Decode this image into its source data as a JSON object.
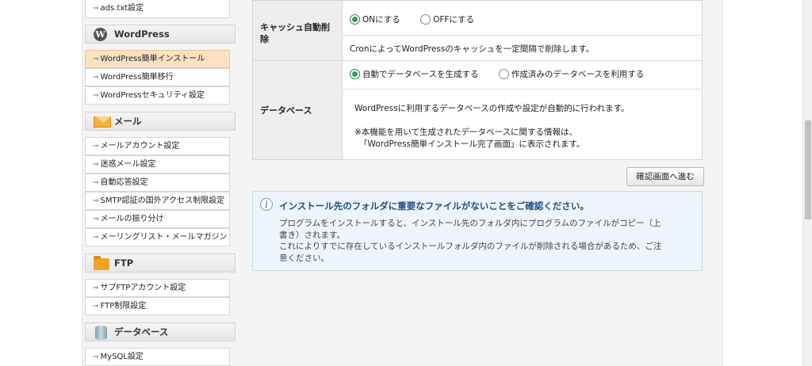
{
  "sidebar": {
    "links_top": [
      "ads.txt設定"
    ],
    "wordpress": {
      "title": "WordPress",
      "icon": "wordpress-logo-icon",
      "items": [
        "WordPress簡単インストール",
        "WordPress簡単移行",
        "WordPressセキュリティ設定"
      ],
      "active_index": 0
    },
    "mail": {
      "title": "メール",
      "icon": "envelope-icon",
      "items": [
        "メールアカウント設定",
        "迷惑メール設定",
        "自動応答設定",
        "SMTP認証の国外アクセス制限設定",
        "メールの振り分け",
        "メーリングリスト・メールマガジン"
      ]
    },
    "ftp": {
      "title": "FTP",
      "icon": "folder-icon",
      "items": [
        "サブFTPアカウント設定",
        "FTP制限設定"
      ]
    },
    "database": {
      "title": "データベース",
      "icon": "database-icon",
      "items": [
        "MySQL設定"
      ]
    }
  },
  "form": {
    "cache": {
      "label": "キャッシュ自動削除",
      "options": [
        "ONにする",
        "OFFにする"
      ],
      "selected": 0,
      "description": "CronによってWordPressのキャッシュを一定間隔で削除します。"
    },
    "database": {
      "label": "データベース",
      "options": [
        "自動でデータベースを生成する",
        "作成済みのデータベースを利用する"
      ],
      "selected": 0,
      "description": "WordPressに利用するデータベースの作成や設定が自動的に行われます。",
      "note_line1": "※本機能を用いて生成されたデータベースに関する情報は、",
      "note_line2": "「WordPress簡単インストール完了画面」に表示されます。"
    }
  },
  "confirm_button": "確認画面へ進む",
  "notice": {
    "icon": "info-icon",
    "title": "インストール先のフォルダに重要なファイルがないことをご確認ください。",
    "line1": "プログラムをインストールすると、インストール先のフォルダ内にプログラムのファイルがコピー（上",
    "line2": "書き）されます。",
    "line3": "これによりすでに存在しているインストールフォルダ内のファイルが削除される場合があるため、ご注",
    "line4": "意ください。"
  },
  "colors": {
    "active_item_bg": "#fde1c0",
    "notice_title": "#1e4f86",
    "radio_selected": "#2fa24a"
  }
}
